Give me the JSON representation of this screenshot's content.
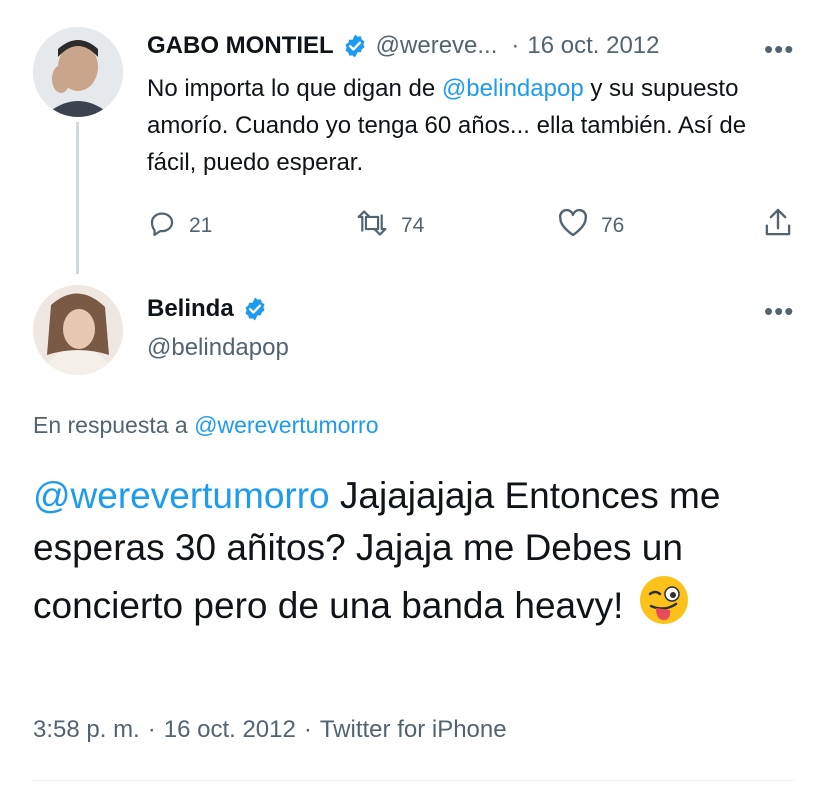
{
  "tweet1": {
    "name": "GABO MONTIEL",
    "handle": "@wereve...",
    "dot": "·",
    "date": "16 oct. 2012",
    "more": "•••",
    "text_pre": "No importa lo que digan de ",
    "mention": "@belindapop",
    "text_post": " y su supuesto amorío. Cuando yo tenga 60 años... ella también. Así de fácil, puedo esperar.",
    "replies": "21",
    "retweets": "74",
    "likes": "76"
  },
  "tweet2": {
    "name": "Belinda",
    "handle": "@belindapop",
    "more": "•••",
    "reply_prefix": "En respuesta a ",
    "reply_to": "@werevertumorro",
    "mention": "@werevertumorro",
    "text": " Jajajajaja Entonces me esperas 30 añitos?  Jajaja me Debes un concierto pero de una banda heavy! ",
    "emoji": "😜",
    "time": "3:58 p. m.",
    "sep": "·",
    "date": "16 oct. 2012",
    "sep2": "·",
    "source": "Twitter for iPhone"
  },
  "colors": {
    "accent": "#1d9bf0",
    "muted": "#536471",
    "text": "#0f1419"
  }
}
